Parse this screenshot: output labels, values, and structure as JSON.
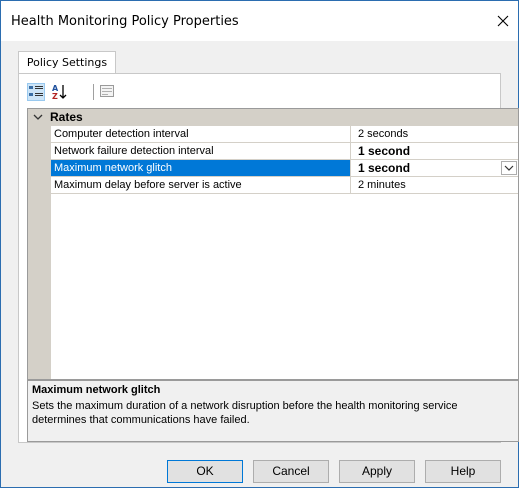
{
  "window": {
    "title": "Health Monitoring Policy Properties"
  },
  "tabs": [
    {
      "label": "Policy Settings",
      "selected": true
    }
  ],
  "toolbar": {
    "buttons": [
      {
        "icon": "categorized-icon",
        "active": true
      },
      {
        "icon": "alphabetical-sort-icon",
        "active": false
      },
      {
        "icon": "property-pages-icon",
        "active": false
      }
    ]
  },
  "grid": {
    "category": {
      "label": "Rates",
      "expanded": true
    },
    "rows": [
      {
        "name": "Computer detection interval",
        "value": "2 seconds",
        "bold": false,
        "selected": false
      },
      {
        "name": "Network failure detection interval",
        "value": "1 second",
        "bold": true,
        "selected": false
      },
      {
        "name": "Maximum network glitch",
        "value": "1 second",
        "bold": true,
        "selected": true
      },
      {
        "name": "Maximum delay before server is active",
        "value": "2 minutes",
        "bold": false,
        "selected": false
      }
    ]
  },
  "description": {
    "title": "Maximum network glitch",
    "text": "Sets the maximum duration of a network disruption before the health monitoring service determines that communications have failed."
  },
  "buttons": {
    "ok": "OK",
    "cancel": "Cancel",
    "apply": "Apply",
    "help": "Help"
  },
  "colors": {
    "selection": "#0078d7",
    "window_border": "#2b6db0",
    "category_bg": "#d4d0c8"
  }
}
